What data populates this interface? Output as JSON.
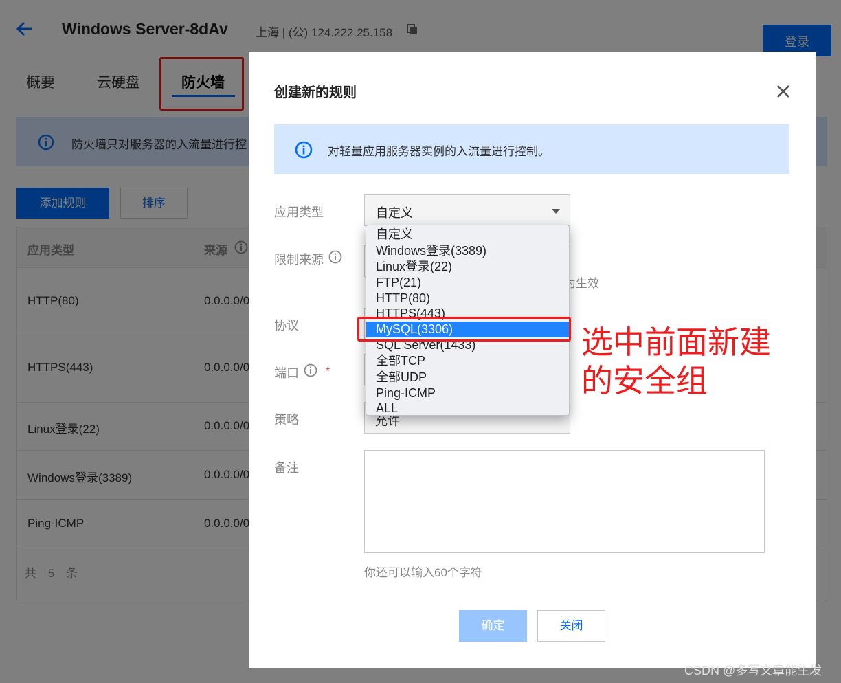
{
  "header": {
    "title": "Windows Server-8dAv",
    "server_info": "上海 | (公) 124.222.25.158",
    "login_label": "登录"
  },
  "tabs": [
    {
      "label": "概要"
    },
    {
      "label": "云硬盘"
    },
    {
      "label": "防火墙",
      "active": true
    }
  ],
  "notice": {
    "text": "防火墙只对服务器的入流量进行控"
  },
  "toolbar": {
    "add_rule_label": "添加规则",
    "sort_label": "排序"
  },
  "table": {
    "headers": [
      "应用类型",
      "来源"
    ],
    "rows": [
      {
        "type": "HTTP(80)",
        "source": "0.0.0.0/0"
      },
      {
        "type": "HTTPS(443)",
        "source": "0.0.0.0/0"
      },
      {
        "type": "Linux登录(22)",
        "source": "0.0.0.0/0"
      },
      {
        "type": "Windows登录(3389)",
        "source": "0.0.0.0/0"
      },
      {
        "type": "Ping-ICMP",
        "source": "0.0.0.0/0"
      }
    ],
    "total_text": "共 5 条"
  },
  "modal": {
    "title": "创建新的规则",
    "notice": "对轻量应用服务器实例的入流量进行控制。",
    "labels": {
      "app_type": "应用类型",
      "source": "限制来源",
      "protocol": "协议",
      "port": "端口",
      "strategy": "策略",
      "remark": "备注"
    },
    "required_mark": "*",
    "app_type_value": "自定义",
    "source_hint_fragment": "为生效",
    "strategy_value": "允许",
    "char_hint": "你还可以输入60个字符",
    "ok_label": "确定",
    "close_label": "关闭"
  },
  "dropdown": {
    "options": [
      "自定义",
      "Windows登录(3389)",
      "Linux登录(22)",
      "FTP(21)",
      "HTTP(80)",
      "HTTPS(443)",
      "MySQL(3306)",
      "SQL Server(1433)",
      "全部TCP",
      "全部UDP",
      "Ping-ICMP",
      "ALL"
    ],
    "selected_index": 6
  },
  "annotation": {
    "text": "选中前面新建的安全组"
  },
  "watermark": "CSDN @多写文章能生发",
  "colors": {
    "accent": "#006eff",
    "annotation_red": "#ee1c1c",
    "selected": "#1e84ff"
  }
}
